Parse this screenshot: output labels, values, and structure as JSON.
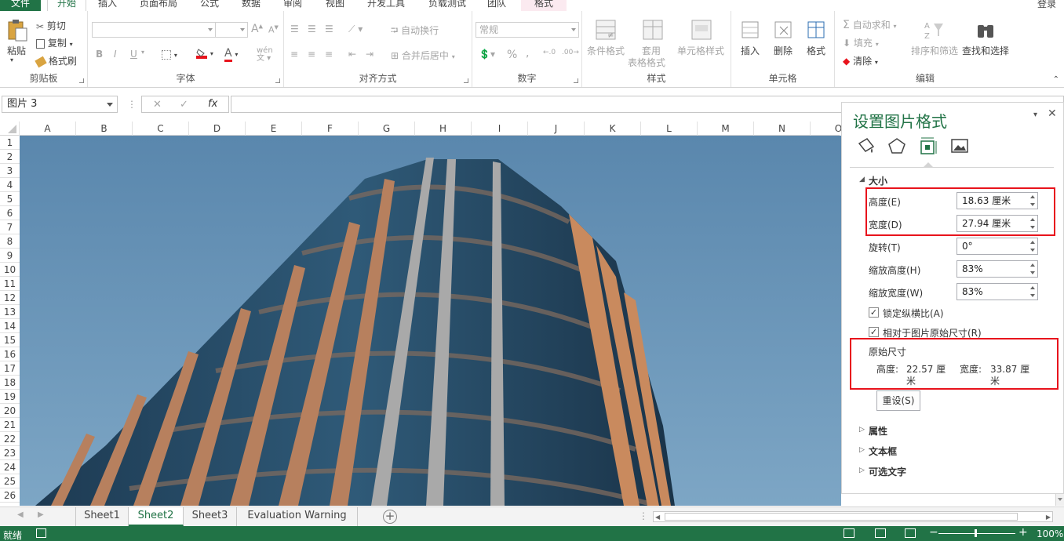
{
  "tabs": {
    "file": "文件",
    "home": "开始",
    "insert": "插入",
    "page_layout": "页面布局",
    "formulas": "公式",
    "data": "数据",
    "review": "审阅",
    "view": "视图",
    "developer": "开发工具",
    "load_test": "负载测试",
    "team": "团队",
    "format": "格式",
    "login": "登录"
  },
  "ribbon": {
    "clipboard": {
      "paste": "粘贴",
      "cut": "剪切",
      "copy": "复制",
      "format_painter": "格式刷",
      "label": "剪贴板"
    },
    "font": {
      "label": "字体",
      "bold": "B",
      "italic": "I",
      "underline": "U",
      "wen": "wén",
      "a_big": "A",
      "a_small": "A"
    },
    "alignment": {
      "wrap": "自动换行",
      "merge": "合并后居中",
      "label": "对齐方式"
    },
    "number": {
      "format": "常规",
      "percent": "%",
      "comma": ",",
      "label": "数字"
    },
    "styles": {
      "conditional": "条件格式",
      "table_format_1": "套用",
      "table_format_2": "表格格式",
      "cell_styles": "单元格样式",
      "label": "样式"
    },
    "cells": {
      "insert": "插入",
      "delete": "删除",
      "format": "格式",
      "label": "单元格"
    },
    "editing": {
      "autosum": "自动求和",
      "fill": "填充",
      "clear": "清除",
      "sort_filter": "排序和筛选",
      "find_select": "查找和选择",
      "label": "编辑"
    }
  },
  "formula_bar": {
    "name_box": "图片 3",
    "fx": "fx",
    "value": ""
  },
  "columns": [
    "A",
    "B",
    "C",
    "D",
    "E",
    "F",
    "G",
    "H",
    "I",
    "J",
    "K",
    "L",
    "M",
    "N",
    "O"
  ],
  "rows": [
    "1",
    "2",
    "3",
    "4",
    "5",
    "6",
    "7",
    "8",
    "9",
    "10",
    "11",
    "12",
    "13",
    "14",
    "15",
    "16",
    "17",
    "18",
    "19",
    "20",
    "21",
    "22",
    "23",
    "24",
    "25",
    "26"
  ],
  "panel": {
    "title": "设置图片格式",
    "size_section": "大小",
    "height_label": "高度(E)",
    "height_value": "18.63 厘米",
    "width_label": "宽度(D)",
    "width_value": "27.94 厘米",
    "rotation_label": "旋转(T)",
    "rotation_value": "0°",
    "scale_h_label": "缩放高度(H)",
    "scale_h_value": "83%",
    "scale_w_label": "缩放宽度(W)",
    "scale_w_value": "83%",
    "lock_ratio": "锁定纵横比(A)",
    "relative_original": "相对于图片原始尺寸(R)",
    "original_size_title": "原始尺寸",
    "orig_height_label": "高度:",
    "orig_height_value": "22.57 厘",
    "orig_height_unit": "米",
    "orig_width_label": "宽度:",
    "orig_width_value": "33.87 厘",
    "orig_width_unit": "米",
    "reset_button": "重设(S)",
    "properties": "属性",
    "textbox": "文本框",
    "alt_text": "可选文字"
  },
  "sheets": [
    "Sheet1",
    "Sheet2",
    "Sheet3",
    "Evaluation Warning"
  ],
  "status": {
    "ready": "就绪",
    "zoom": "100%"
  },
  "colors": {
    "accent": "#217346",
    "highlight": "#e8131c",
    "sky": "#5f8fb1"
  }
}
